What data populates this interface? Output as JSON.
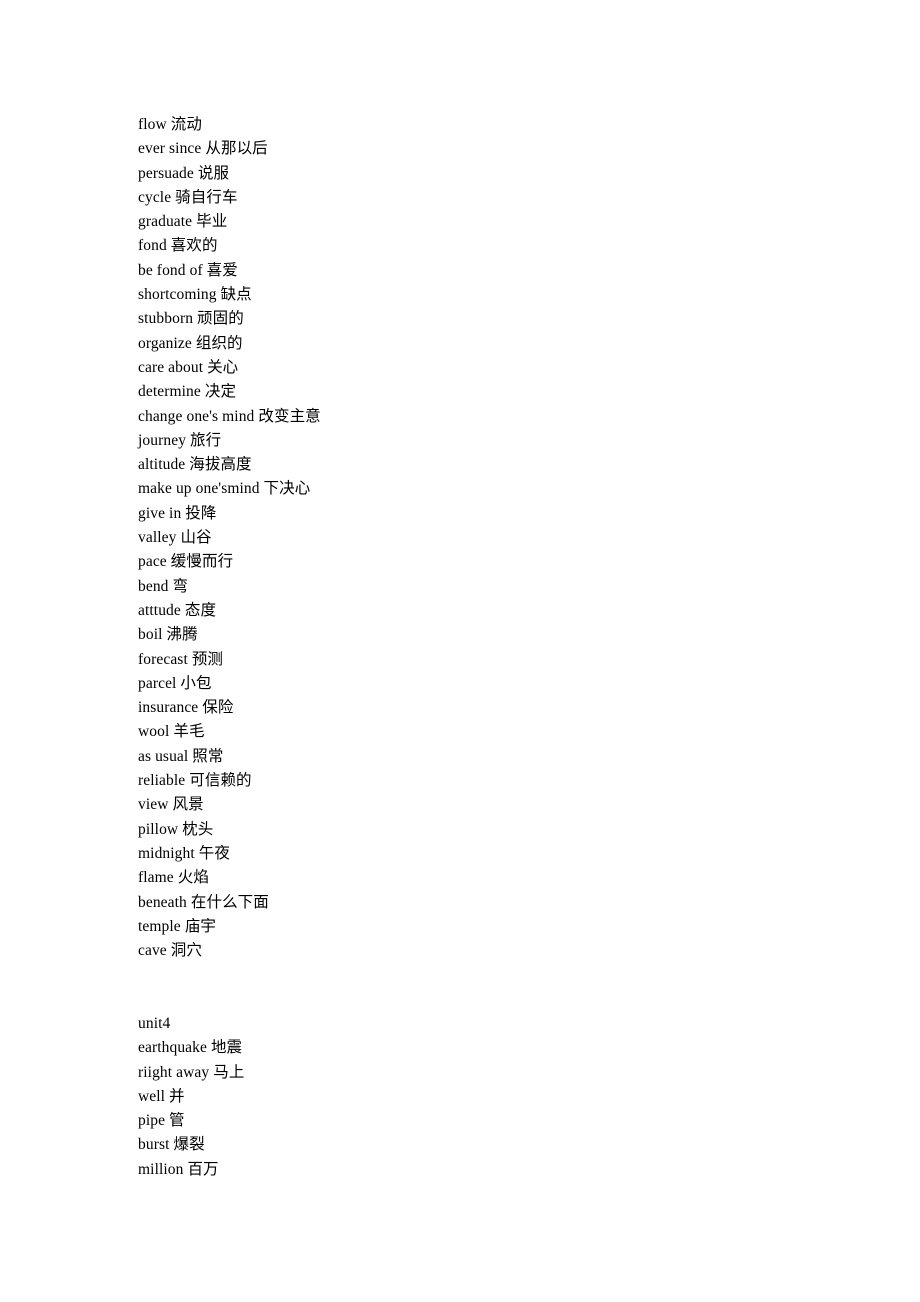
{
  "document": {
    "type": "vocabulary-list",
    "background_color": "#ffffff",
    "text_color": "#000000",
    "blocks": [
      {
        "id": "block-1",
        "lines": [
          "flow 流动",
          "ever since 从那以后",
          "persuade 说服",
          "cycle 骑自行车",
          "graduate 毕业",
          "fond 喜欢的",
          "be fond of 喜爱",
          "shortcoming 缺点",
          "stubborn 顽固的",
          "organize 组织的",
          "care about 关心",
          "determine 决定",
          "change one's mind 改变主意",
          "journey 旅行",
          "altitude 海拔高度",
          "make up one'smind 下决心",
          "give in 投降",
          "valley 山谷",
          "pace 缓慢而行",
          "bend 弯",
          "atttude 态度",
          "boil 沸腾",
          "forecast 预测",
          "parcel 小包",
          "insurance 保险",
          "wool 羊毛",
          "as usual 照常",
          "reliable 可信赖的",
          "view 风景",
          "pillow 枕头",
          "midnight 午夜",
          "flame 火焰",
          "beneath 在什么下面",
          "temple 庙宇",
          "cave 洞穴"
        ]
      },
      {
        "id": "block-2",
        "lines": [
          "unit4",
          "earthquake 地震",
          "riight away 马上",
          "well 并",
          "pipe 管",
          "burst 爆裂",
          "million 百万"
        ]
      }
    ]
  }
}
